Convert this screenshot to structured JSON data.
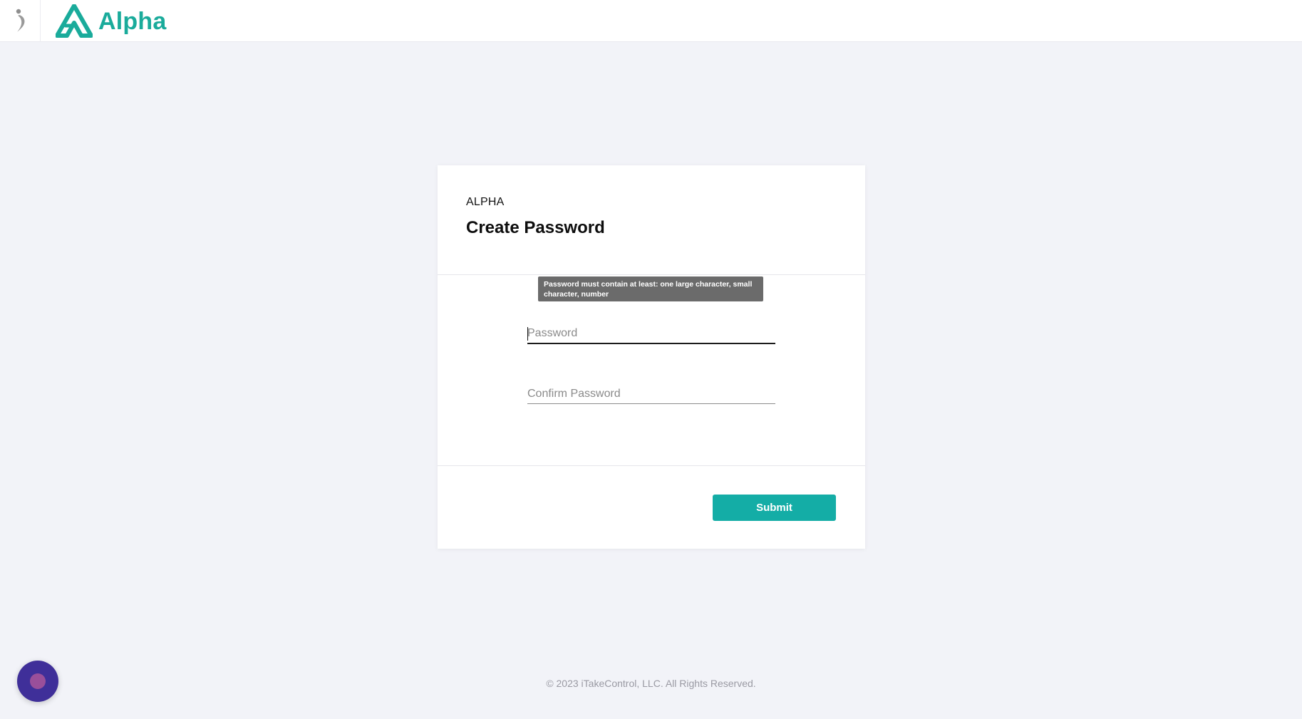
{
  "header": {
    "brand_name": "Alpha",
    "brand_color": "#1aab9b",
    "small_logo_icon": "figure-logo-icon",
    "brand_logo_icon": "alpha-triangle-logo-icon"
  },
  "card": {
    "eyebrow": "ALPHA",
    "title": "Create Password",
    "tooltip": "Password must contain at least: one large character, small character, number",
    "password": {
      "placeholder": "Password",
      "value": ""
    },
    "confirm_password": {
      "placeholder": "Confirm Password",
      "value": ""
    },
    "submit_label": "Submit",
    "accent_color": "#14ada6"
  },
  "footer": {
    "copyright": "© 2023 iTakeControl, LLC. All Rights Reserved."
  },
  "chat_widget": {
    "icon": "chat-launcher-icon",
    "color": "#3f2f99"
  }
}
